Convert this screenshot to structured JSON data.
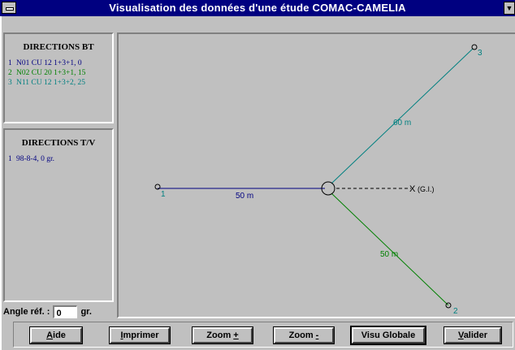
{
  "window": {
    "title": "Visualisation des données d'une étude COMAC-CAMELIA",
    "scroll_glyph": "▼"
  },
  "directions_bt": {
    "title": "DIRECTIONS BT",
    "items": [
      {
        "num": "1",
        "text": "N01 CU 12 1+3+1, 0",
        "color": "#000080"
      },
      {
        "num": "2",
        "text": "N02 CU 20 1+3+1, 15",
        "color": "#008000"
      },
      {
        "num": "3",
        "text": "N11 CU 12 1+3+2, 25",
        "color": "#008080"
      }
    ]
  },
  "directions_tv": {
    "title": "DIRECTIONS T/V",
    "items": [
      {
        "num": "1",
        "text": "98-8-4, 0 gr.",
        "color": "#000080"
      }
    ]
  },
  "angle": {
    "label": "Angle réf. :",
    "value": "0",
    "unit": "gr."
  },
  "diagram": {
    "branches": [
      {
        "id": "1",
        "length_label": "50 m",
        "color": "#000080"
      },
      {
        "id": "2",
        "length_label": "50 m",
        "color": "#008000"
      },
      {
        "id": "3",
        "length_label": "60 m",
        "color": "#008080"
      }
    ],
    "gi_label": "(G.I.)",
    "gi_mark": "X"
  },
  "buttons": [
    {
      "id": "aide",
      "pre": "",
      "ul": "A",
      "post": "ide"
    },
    {
      "id": "imprimer",
      "pre": "",
      "ul": "I",
      "post": "mprimer"
    },
    {
      "id": "zoom-plus",
      "pre": "Zoom ",
      "ul": "+",
      "post": ""
    },
    {
      "id": "zoom-minus",
      "pre": "Zoom ",
      "ul": "-",
      "post": ""
    },
    {
      "id": "visu-globale",
      "pre": "Visu Globale",
      "ul": "",
      "post": ""
    },
    {
      "id": "valider",
      "pre": "",
      "ul": "V",
      "post": "alider"
    }
  ]
}
